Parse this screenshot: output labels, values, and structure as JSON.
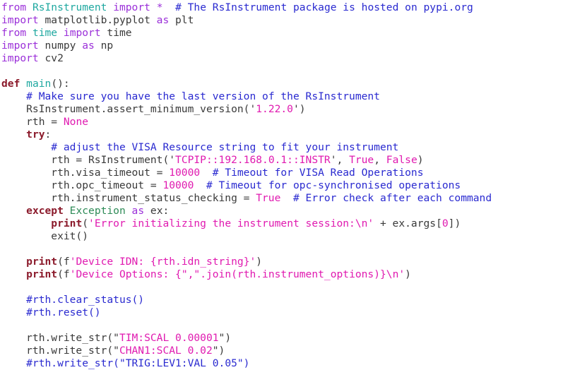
{
  "editor": {
    "language": "python",
    "background_color": "#ffffff",
    "colors": {
      "keyword": "#9b30d9",
      "keyword_bold": "#8b1a2b",
      "module": "#1fa8a0",
      "comment": "#2a2ad0",
      "string": "#e01ab0",
      "number": "#e01ab0",
      "constant": "#e01ab0",
      "exception": "#2e8b57",
      "plain": "#3a3a3a"
    }
  },
  "code": {
    "lines": [
      {
        "n": 1,
        "text": "from RsInstrument import *  # The RsInstrument package is hosted on pypi.org",
        "tokens": [
          {
            "t": "from",
            "c": "t-kw"
          },
          {
            "t": " ",
            "c": "t-plain"
          },
          {
            "t": "RsInstrument",
            "c": "t-mod"
          },
          {
            "t": " ",
            "c": "t-plain"
          },
          {
            "t": "import",
            "c": "t-kw"
          },
          {
            "t": " ",
            "c": "t-plain"
          },
          {
            "t": "*",
            "c": "t-kw"
          },
          {
            "t": "  ",
            "c": "t-plain"
          },
          {
            "t": "# The RsInstrument package is hosted on pypi.org",
            "c": "t-comment"
          }
        ]
      },
      {
        "n": 2,
        "text": "import matplotlib.pyplot as plt",
        "tokens": [
          {
            "t": "import",
            "c": "t-kw"
          },
          {
            "t": " matplotlib.pyplot ",
            "c": "t-plain"
          },
          {
            "t": "as",
            "c": "t-kw"
          },
          {
            "t": " plt",
            "c": "t-plain"
          }
        ]
      },
      {
        "n": 3,
        "text": "from time import time",
        "tokens": [
          {
            "t": "from",
            "c": "t-kw"
          },
          {
            "t": " ",
            "c": "t-plain"
          },
          {
            "t": "time",
            "c": "t-mod"
          },
          {
            "t": " ",
            "c": "t-plain"
          },
          {
            "t": "import",
            "c": "t-kw"
          },
          {
            "t": " time",
            "c": "t-plain"
          }
        ]
      },
      {
        "n": 4,
        "text": "import numpy as np",
        "tokens": [
          {
            "t": "import",
            "c": "t-kw"
          },
          {
            "t": " numpy ",
            "c": "t-plain"
          },
          {
            "t": "as",
            "c": "t-kw"
          },
          {
            "t": " np",
            "c": "t-plain"
          }
        ]
      },
      {
        "n": 5,
        "text": "import cv2",
        "tokens": [
          {
            "t": "import",
            "c": "t-kw"
          },
          {
            "t": " cv2",
            "c": "t-plain"
          }
        ]
      },
      {
        "n": 6,
        "text": "",
        "tokens": []
      },
      {
        "n": 7,
        "text": "def main():",
        "tokens": [
          {
            "t": "def",
            "c": "t-kw2"
          },
          {
            "t": " ",
            "c": "t-plain"
          },
          {
            "t": "main",
            "c": "t-fn"
          },
          {
            "t": "():",
            "c": "t-plain"
          }
        ]
      },
      {
        "n": 8,
        "text": "    # Make sure you have the last version of the RsInstrument",
        "tokens": [
          {
            "t": "    ",
            "c": "t-plain"
          },
          {
            "t": "# Make sure you have the last version of the RsInstrument",
            "c": "t-comment"
          }
        ]
      },
      {
        "n": 9,
        "text": "    RsInstrument.assert_minimum_version('1.22.0')",
        "tokens": [
          {
            "t": "    RsInstrument.assert_minimum_version(",
            "c": "t-plain"
          },
          {
            "t": "'",
            "c": "t-plain"
          },
          {
            "t": "1.22.0",
            "c": "t-str"
          },
          {
            "t": "'",
            "c": "t-plain"
          },
          {
            "t": ")",
            "c": "t-plain"
          }
        ]
      },
      {
        "n": 10,
        "text": "    rth = None",
        "tokens": [
          {
            "t": "    rth = ",
            "c": "t-plain"
          },
          {
            "t": "None",
            "c": "t-const"
          }
        ]
      },
      {
        "n": 11,
        "text": "    try:",
        "tokens": [
          {
            "t": "    ",
            "c": "t-plain"
          },
          {
            "t": "try",
            "c": "t-kw2"
          },
          {
            "t": ":",
            "c": "t-plain"
          }
        ]
      },
      {
        "n": 12,
        "text": "        # adjust the VISA Resource string to fit your instrument",
        "tokens": [
          {
            "t": "        ",
            "c": "t-plain"
          },
          {
            "t": "# adjust the VISA Resource string to fit your instrument",
            "c": "t-comment"
          }
        ]
      },
      {
        "n": 13,
        "text": "        rth = RsInstrument('TCPIP::192.168.0.1::INSTR', True, False)",
        "tokens": [
          {
            "t": "        rth = RsInstrument(",
            "c": "t-plain"
          },
          {
            "t": "'",
            "c": "t-plain"
          },
          {
            "t": "TCPIP::192.168.0.1::INSTR",
            "c": "t-str"
          },
          {
            "t": "'",
            "c": "t-plain"
          },
          {
            "t": ", ",
            "c": "t-plain"
          },
          {
            "t": "True",
            "c": "t-const"
          },
          {
            "t": ", ",
            "c": "t-plain"
          },
          {
            "t": "False",
            "c": "t-const"
          },
          {
            "t": ")",
            "c": "t-plain"
          }
        ]
      },
      {
        "n": 14,
        "text": "        rth.visa_timeout = 10000  # Timeout for VISA Read Operations",
        "tokens": [
          {
            "t": "        rth.visa_timeout = ",
            "c": "t-plain"
          },
          {
            "t": "10000",
            "c": "t-num"
          },
          {
            "t": "  ",
            "c": "t-plain"
          },
          {
            "t": "# Timeout for VISA Read Operations",
            "c": "t-comment"
          }
        ]
      },
      {
        "n": 15,
        "text": "        rth.opc_timeout = 10000  # Timeout for opc-synchronised operations",
        "tokens": [
          {
            "t": "        rth.opc_timeout = ",
            "c": "t-plain"
          },
          {
            "t": "10000",
            "c": "t-num"
          },
          {
            "t": "  ",
            "c": "t-plain"
          },
          {
            "t": "# Timeout for opc-synchronised operations",
            "c": "t-comment"
          }
        ]
      },
      {
        "n": 16,
        "text": "        rth.instrument_status_checking = True  # Error check after each command",
        "tokens": [
          {
            "t": "        rth.instrument_status_checking = ",
            "c": "t-plain"
          },
          {
            "t": "True",
            "c": "t-const"
          },
          {
            "t": "  ",
            "c": "t-plain"
          },
          {
            "t": "# Error check after each command",
            "c": "t-comment"
          }
        ]
      },
      {
        "n": 17,
        "text": "    except Exception as ex:",
        "tokens": [
          {
            "t": "    ",
            "c": "t-plain"
          },
          {
            "t": "except",
            "c": "t-kw2"
          },
          {
            "t": " ",
            "c": "t-plain"
          },
          {
            "t": "Exception",
            "c": "t-exc"
          },
          {
            "t": " ",
            "c": "t-plain"
          },
          {
            "t": "as",
            "c": "t-kw"
          },
          {
            "t": " ex:",
            "c": "t-plain"
          }
        ]
      },
      {
        "n": 18,
        "text": "        print('Error initializing the instrument session:\\n' + ex.args[0])",
        "tokens": [
          {
            "t": "        ",
            "c": "t-plain"
          },
          {
            "t": "print",
            "c": "t-kw2"
          },
          {
            "t": "(",
            "c": "t-plain"
          },
          {
            "t": "'Error initializing the instrument session:\\n'",
            "c": "t-str"
          },
          {
            "t": " + ex.args[",
            "c": "t-plain"
          },
          {
            "t": "0",
            "c": "t-num"
          },
          {
            "t": "])",
            "c": "t-plain"
          }
        ]
      },
      {
        "n": 19,
        "text": "        exit()",
        "tokens": [
          {
            "t": "        exit()",
            "c": "t-plain"
          }
        ]
      },
      {
        "n": 20,
        "text": "",
        "tokens": []
      },
      {
        "n": 21,
        "text": "    print(f'Device IDN: {rth.idn_string}')",
        "tokens": [
          {
            "t": "    ",
            "c": "t-plain"
          },
          {
            "t": "print",
            "c": "t-kw2"
          },
          {
            "t": "(",
            "c": "t-plain"
          },
          {
            "t": "f",
            "c": "t-plain"
          },
          {
            "t": "'Device IDN: {rth.idn_string}'",
            "c": "t-str"
          },
          {
            "t": ")",
            "c": "t-plain"
          }
        ]
      },
      {
        "n": 22,
        "text": "    print(f'Device Options: {\",\".join(rth.instrument_options)}\\n')",
        "tokens": [
          {
            "t": "    ",
            "c": "t-plain"
          },
          {
            "t": "print",
            "c": "t-kw2"
          },
          {
            "t": "(",
            "c": "t-plain"
          },
          {
            "t": "f",
            "c": "t-plain"
          },
          {
            "t": "'Device Options: {\",\".join(rth.instrument_options)}\\n'",
            "c": "t-str"
          },
          {
            "t": ")",
            "c": "t-plain"
          }
        ]
      },
      {
        "n": 23,
        "text": "",
        "tokens": []
      },
      {
        "n": 24,
        "text": "    #rth.clear_status()",
        "tokens": [
          {
            "t": "    ",
            "c": "t-plain"
          },
          {
            "t": "#rth.clear_status()",
            "c": "t-comment"
          }
        ]
      },
      {
        "n": 25,
        "text": "    #rth.reset()",
        "tokens": [
          {
            "t": "    ",
            "c": "t-plain"
          },
          {
            "t": "#rth.reset()",
            "c": "t-comment"
          }
        ]
      },
      {
        "n": 26,
        "text": "",
        "tokens": []
      },
      {
        "n": 27,
        "text": "    rth.write_str(\"TIM:SCAL 0.00001\")",
        "tokens": [
          {
            "t": "    rth.write_str(",
            "c": "t-plain"
          },
          {
            "t": "\"",
            "c": "t-plain"
          },
          {
            "t": "TIM:SCAL 0.00001",
            "c": "t-str"
          },
          {
            "t": "\"",
            "c": "t-plain"
          },
          {
            "t": ")",
            "c": "t-plain"
          }
        ]
      },
      {
        "n": 28,
        "text": "    rth.write_str(\"CHAN1:SCAL 0.02\")",
        "tokens": [
          {
            "t": "    rth.write_str(",
            "c": "t-plain"
          },
          {
            "t": "\"",
            "c": "t-plain"
          },
          {
            "t": "CHAN1:SCAL 0.02",
            "c": "t-str"
          },
          {
            "t": "\"",
            "c": "t-plain"
          },
          {
            "t": ")",
            "c": "t-plain"
          }
        ]
      },
      {
        "n": 29,
        "text": "    #rth.write_str(\"TRIG:LEV1:VAL 0.05\")",
        "tokens": [
          {
            "t": "    ",
            "c": "t-plain"
          },
          {
            "t": "#rth.write_str(\"TRIG:LEV1:VAL 0.05\")",
            "c": "t-comment"
          }
        ]
      }
    ]
  }
}
